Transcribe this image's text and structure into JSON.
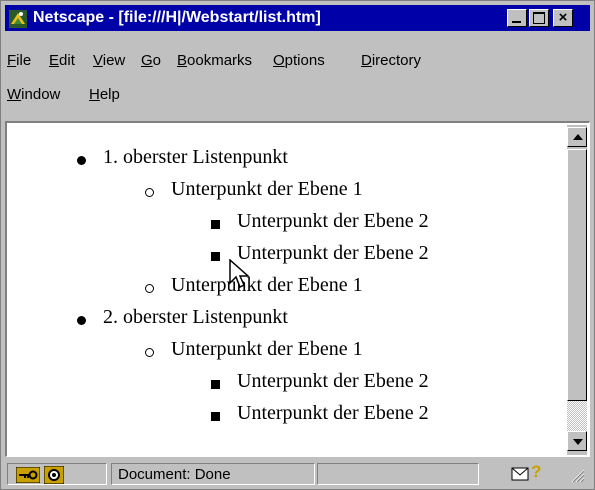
{
  "window": {
    "title": "Netscape - [file:///H|/Webstart/list.htm]",
    "app_icon": "netscape-icon",
    "controls": [
      "minimize-icon",
      "maximize-icon",
      "close-icon"
    ],
    "close_glyph": "×"
  },
  "menu": {
    "row1": [
      {
        "key": "F",
        "rest": "ile"
      },
      {
        "key": "E",
        "rest": "dit"
      },
      {
        "key": "V",
        "rest": "iew"
      },
      {
        "key": "G",
        "rest": "o"
      },
      {
        "key": "B",
        "rest": "ookmarks"
      },
      {
        "key": "O",
        "rest": "ptions"
      },
      {
        "key": "D",
        "rest": "irectory"
      }
    ],
    "row2": [
      {
        "key": "W",
        "rest": "indow"
      },
      {
        "key": "H",
        "rest": "elp"
      }
    ]
  },
  "list": [
    {
      "level": 0,
      "bullet": "disc",
      "text": "1. oberster Listenpunkt"
    },
    {
      "level": 1,
      "bullet": "circle",
      "text": "Unterpunkt der Ebene 1"
    },
    {
      "level": 2,
      "bullet": "square",
      "text": "Unterpunkt der Ebene 2"
    },
    {
      "level": 2,
      "bullet": "square",
      "text": "Unterpunkt der Ebene 2"
    },
    {
      "level": 1,
      "bullet": "circle",
      "text": "Unterpunkt der Ebene 1"
    },
    {
      "level": 0,
      "bullet": "disc",
      "text": "2. oberster Listenpunkt"
    },
    {
      "level": 1,
      "bullet": "circle",
      "text": "Unterpunkt der Ebene 1"
    },
    {
      "level": 2,
      "bullet": "square",
      "text": "Unterpunkt der Ebene 2"
    },
    {
      "level": 2,
      "bullet": "square",
      "text": "Unterpunkt der Ebene 2"
    }
  ],
  "status": {
    "text": "Document: Done",
    "icons": [
      "key-icon",
      "lock-icon",
      "mail-icon",
      "help-icon",
      "resize-grip-icon"
    ],
    "help_glyph": "?"
  },
  "colors": {
    "title_bar": "#0000a8",
    "chrome": "#c0c0c0",
    "content_bg": "#ffffff"
  }
}
